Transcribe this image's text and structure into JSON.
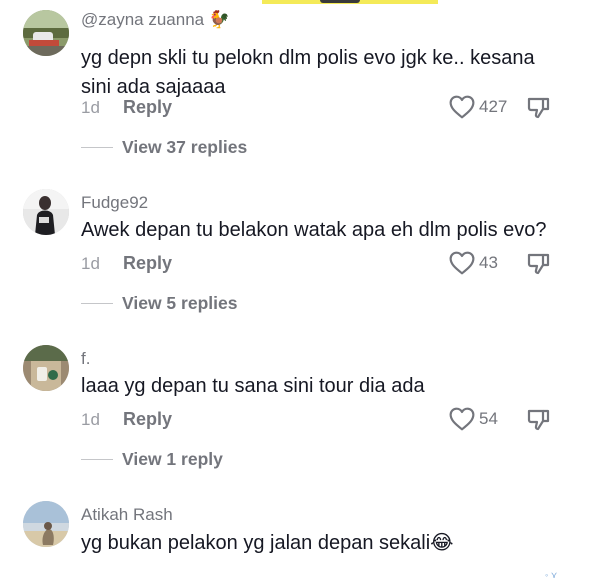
{
  "comments": [
    {
      "username": "@zayna zuanna",
      "username_emoji": "🐓",
      "text_line1": "yg depn skli tu pelokn dlm polis evo jgk ke.. kesana",
      "text_line2": "sini ada sajaaaa",
      "time": "1d",
      "reply_label": "Reply",
      "likes": "427",
      "view_replies": "View 37 replies"
    },
    {
      "username": "Fudge92",
      "text_line1": "Awek depan tu belakon watak apa eh dlm polis evo?",
      "time": "1d",
      "reply_label": "Reply",
      "likes": "43",
      "view_replies": "View 5 replies"
    },
    {
      "username": "f.",
      "text_line1": "laaa yg depan tu sana sini tour dia ada",
      "time": "1d",
      "reply_label": "Reply",
      "likes": "54",
      "view_replies": "View 1 reply"
    },
    {
      "username": "Atikah Rash",
      "text_line1": "yg bukan pelakon yg jalan depan sekali",
      "text_emoji": "😂"
    }
  ],
  "icons": {
    "like": "heart-outline-icon",
    "dislike": "thumbs-down-outline-icon"
  },
  "colors": {
    "primary_text": "#161823",
    "secondary_text": "#73757c",
    "muted_text": "#9a9ca3"
  }
}
